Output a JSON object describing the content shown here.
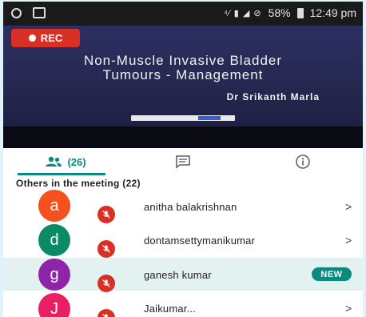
{
  "status_bar": {
    "battery": "58%",
    "time": "12:49 pm"
  },
  "video": {
    "rec_label": "REC",
    "slide_title_line1": "Non-Muscle Invasive Bladder",
    "slide_title_line2": "Tumours - Management",
    "presenter": "Dr Srikanth Marla"
  },
  "tabs": {
    "people_count": "(26)"
  },
  "participants": {
    "section_title": "Others in the meeting (22)",
    "rows": [
      {
        "initial": "a",
        "name": "anitha balakrishnan",
        "color": "#f4511e"
      },
      {
        "initial": "d",
        "name": "dontamsettymanikumar",
        "color": "#0b8a66"
      },
      {
        "initial": "g",
        "name": "ganesh kumar",
        "color": "#8e24aa",
        "badge": "NEW"
      },
      {
        "initial": "J",
        "name": "Jaikumar...",
        "color": "#e91e63"
      }
    ]
  },
  "colors": {
    "accent": "#0b8a7e",
    "rec": "#d93025"
  }
}
